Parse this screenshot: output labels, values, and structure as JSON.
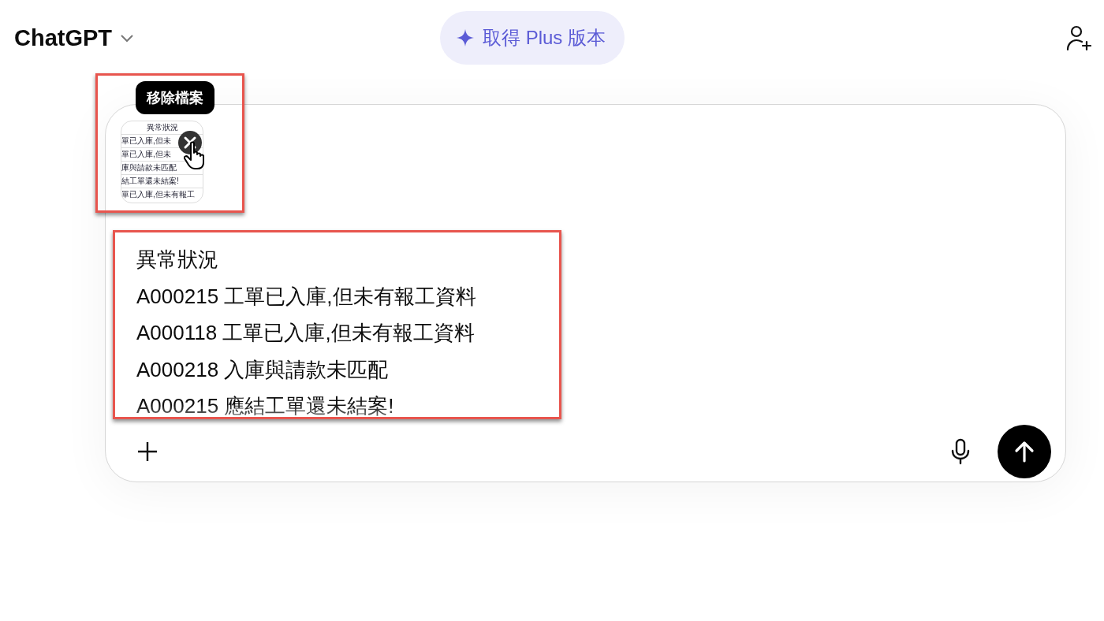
{
  "header": {
    "title": "ChatGPT",
    "upgrade_button": "取得 Plus 版本"
  },
  "composer": {
    "attachment": {
      "tooltip": "移除檔案",
      "thumbnail_lines": [
        "異常狀況",
        "單已入庫,但未",
        "單已入庫,但未",
        "庫與請款未匹配",
        "結工單還未結案!",
        "單已入庫,但未有報工"
      ]
    },
    "message_lines": [
      "異常狀況",
      "A000215 工單已入庫,但未有報工資料",
      "A000118 工單已入庫,但未有報工資料",
      "A000218 入庫與請款未匹配",
      "A000215 應結工單還未結案!"
    ]
  }
}
